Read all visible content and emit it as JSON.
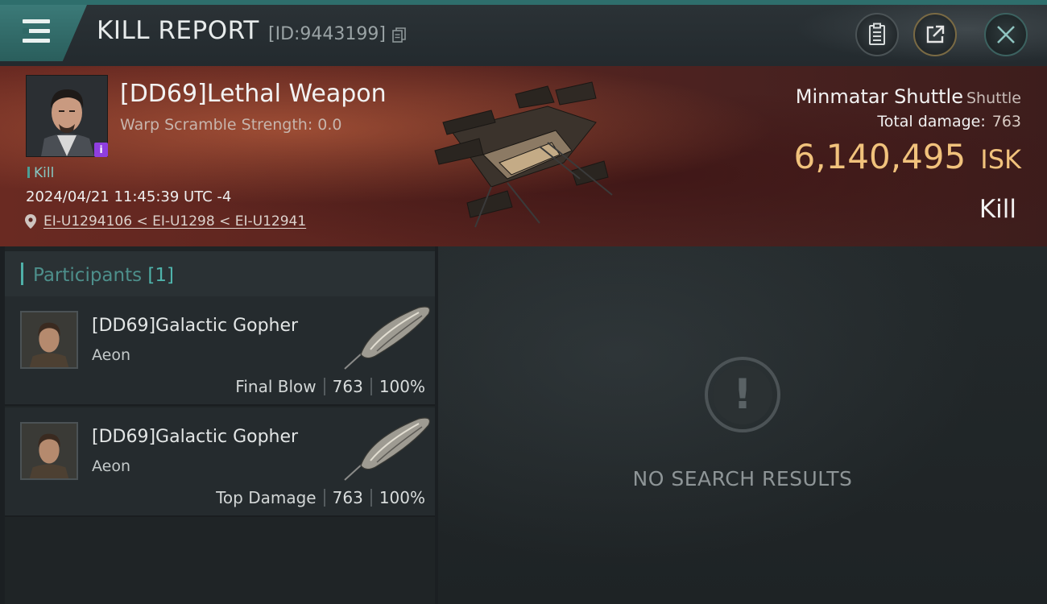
{
  "header": {
    "title": "KILL REPORT",
    "report_id": "[ID:9443199]"
  },
  "victim": {
    "name": "[DD69]Lethal Weapon",
    "scramble": "Warp Scramble Strength: 0.0",
    "kill_tag": "Kill",
    "datetime": "2024/04/21 11:45:39 UTC -4",
    "location": "EI-U1294106 < EI-U1298 < EI-U12941",
    "badge_color": "#8f3ee0"
  },
  "ship": {
    "name": "Minmatar Shuttle",
    "class": "Shuttle",
    "total_damage_label": "Total damage:",
    "total_damage": "763",
    "isk_value": "6,140,495",
    "isk_unit": "ISK",
    "result": "Kill"
  },
  "participants": {
    "title": "Participants",
    "count": "[1]",
    "rows": [
      {
        "name": "[DD69]Galactic Gopher",
        "ship": "Aeon",
        "role": "Final Blow",
        "damage": "763",
        "percent": "100%"
      },
      {
        "name": "[DD69]Galactic Gopher",
        "ship": "Aeon",
        "role": "Top Damage",
        "damage": "763",
        "percent": "100%"
      }
    ]
  },
  "results_panel": {
    "empty_text": "NO SEARCH RESULTS"
  },
  "colors": {
    "accent": "#2e6e6c",
    "isk": "#f1c27c",
    "banner": "#5a241f"
  },
  "icons": [
    "menu-icon",
    "copy-icon",
    "clipboard-icon",
    "share-icon",
    "close-icon",
    "location-pin-icon",
    "exclamation-icon"
  ]
}
